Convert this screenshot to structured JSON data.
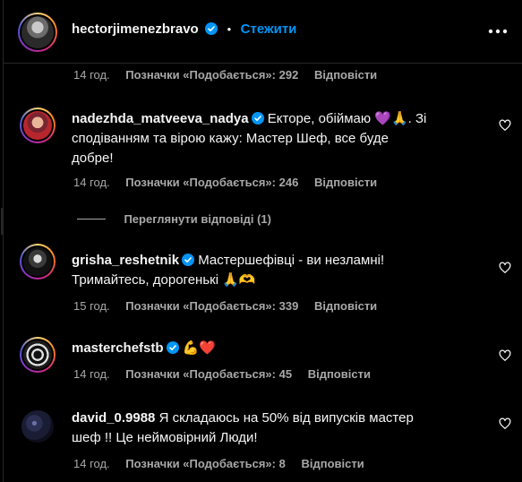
{
  "post_author": {
    "username": "hectorjimenezbravo",
    "dot": "•",
    "follow_label": "Стежити",
    "more_icon": "more-horizontal-icon"
  },
  "top_meta": {
    "time": "14 год.",
    "likes": "Позначки «Подобається»: 292",
    "reply": "Відповісти"
  },
  "comments": [
    {
      "username": "nadezhda_matveeva_nadya",
      "verified": true,
      "text_line1": "Екторе, обіймаю 💜🙏. Зі",
      "text_line2": "сподіванням та вірою кажу: Мастер Шеф, все буде",
      "text_line3": "добре!",
      "time": "14 год.",
      "likes": "Позначки «Подобається»: 246",
      "reply": "Відповісти"
    },
    {
      "username": "grisha_reshetnik",
      "verified": true,
      "text_line1": "Мастершефівці - ви незламні!",
      "text_line2": "Тримайтесь, дорогенькі 🙏🫶",
      "time": "15 год.",
      "likes": "Позначки «Подобається»: 339",
      "reply": "Відповісти"
    },
    {
      "username": "masterchefstb",
      "verified": true,
      "text_line1": "💪❤️",
      "time": "14 год.",
      "likes": "Позначки «Подобається»: 45",
      "reply": "Відповісти"
    },
    {
      "username": "david_0.9988",
      "verified": false,
      "text_line1": "Я складаюсь на 50% від випусків мастер",
      "text_line2": "шеф !! Це неймовірний Люди!",
      "time": "14 год.",
      "likes": "Позначки «Подобається»: 8",
      "reply": "Відповісти"
    }
  ],
  "view_replies": "Переглянути відповіді (1)",
  "colors": {
    "accent": "#0095f6",
    "verified": "#0095f6",
    "muted": "#a8a8a8",
    "background": "#000000"
  }
}
